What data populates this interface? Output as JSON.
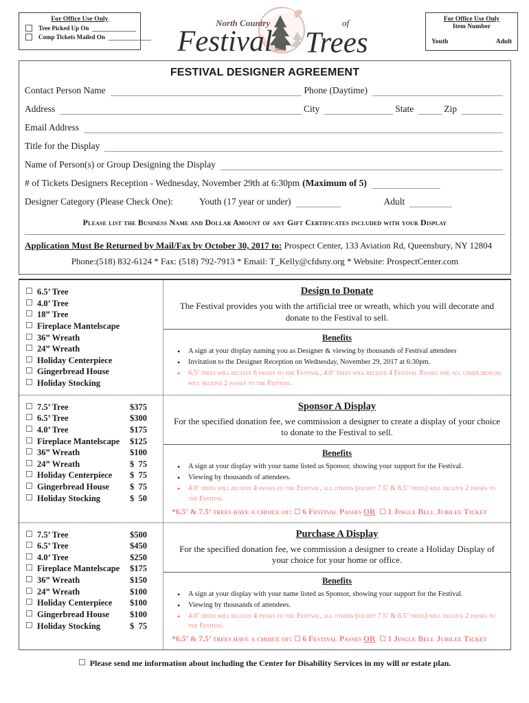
{
  "header": {
    "office_box": {
      "title": "For Office Use Only",
      "rows": [
        {
          "label": "Tree Picked Up On"
        },
        {
          "label": "Comp Tickets Mailed On"
        }
      ]
    },
    "logo": {
      "line_small": "North Country",
      "line_main": "Festival",
      "line_of": "of",
      "line_trees": "Trees"
    },
    "item_box": {
      "title": "For Office Use Only",
      "subtitle": "Item Number",
      "left_label": "Youth",
      "right_label": "Adult"
    }
  },
  "form": {
    "title": "FESTIVAL DESIGNER AGREEMENT",
    "contact_person_label": "Contact Person Name",
    "phone_label": "Phone (Daytime)",
    "address_label": "Address",
    "city_label": "City",
    "state_label": "State",
    "zip_label": "Zip",
    "email_label": "Email Address",
    "title_display_label": "Title for the Display",
    "group_label": "Name of Person(s) or Group Designing the Display",
    "tickets_label": "# of Tickets Designers Reception - Wednesday, November 29th at 6:30pm",
    "tickets_max": "(Maximum of 5)",
    "category_label": "Designer Category (Please Check One):",
    "category_youth": "Youth (17 year or under)",
    "category_adult": "Adult",
    "gift_cert_line": "Please list the Business Name and Dollar Amount of any Gift Certificates included with your Display",
    "return_bold": "Application Must Be Returned by Mail/Fax by October 30, 2017 to:",
    "return_rest": " Prospect Center, 133 Aviation Rd, Queensbury, NY 12804",
    "contact_line": "Phone:(518) 832-6124 * Fax: (518) 792-7913 * Email: T_Kelly@cfdsny.org * Website: ProspectCenter.com"
  },
  "panels": [
    {
      "id": "design-to-donate",
      "title": "Design to Donate",
      "description": "The Festival provides you with the artificial tree or wreath, which you will decorate and donate to the Festival to sell.",
      "benefits_title": "Benefits",
      "options": [
        {
          "name": "6.5’ Tree",
          "price": ""
        },
        {
          "name": "4.0’ Tree",
          "price": ""
        },
        {
          "name": "18” Tree",
          "price": ""
        },
        {
          "name": "Fireplace Mantelscape",
          "price": ""
        },
        {
          "name": "36” Wreath",
          "price": ""
        },
        {
          "name": "24” Wreath",
          "price": ""
        },
        {
          "name": "Holiday Centerpiece",
          "price": ""
        },
        {
          "name": "Gingerbread House",
          "price": ""
        },
        {
          "name": "Holiday Stocking",
          "price": ""
        }
      ],
      "benefits": [
        {
          "text": "A sign at your display naming you as Designer & viewing by thousands of Festival attendees",
          "red": false
        },
        {
          "text": "Invitation to the Designer Reception on Wednesday, November 29, 2017 at 6:30pm.",
          "red": false
        },
        {
          "text": "6.5’ trees will receive 6 passes to the Festival, 4.0’ trees will receive 4 Festival Passes and all other designs will receive 2 passes to the Festival.",
          "red": true
        }
      ],
      "choice_line": null
    },
    {
      "id": "sponsor-a-display",
      "title": "Sponsor A Display",
      "description": "For the specified donation fee, we commission a designer to create a display of your choice to donate to the Festival to sell.",
      "benefits_title": "Benefits",
      "options": [
        {
          "name": "7.5’ Tree",
          "price": "$375"
        },
        {
          "name": "6.5’ Tree",
          "price": "$300"
        },
        {
          "name": "4.0’ Tree",
          "price": "$175"
        },
        {
          "name": "Fireplace Mantelscape",
          "price": "$125"
        },
        {
          "name": "36” Wreath",
          "price": "$100"
        },
        {
          "name": "24” Wreath",
          "price": "$  75"
        },
        {
          "name": "Holiday Centerpiece",
          "price": "$  75"
        },
        {
          "name": "Gingerbread House",
          "price": "$  75"
        },
        {
          "name": "Holiday Stocking",
          "price": "$  50"
        }
      ],
      "benefits": [
        {
          "text": "A sign at your display with your name listed as Sponsor, showing your support for the Festival.",
          "red": false
        },
        {
          "text": "Viewing by thousands of attendees.",
          "red": false
        },
        {
          "text": "4.0’ trees will receive 4 passes to the Festival, all others (except 7.5’ & 6.5’ trees) will receive 2 passes to the Festival.",
          "red": true
        }
      ],
      "choice_line": {
        "prefix": "*6.5’ & 7.5’ trees have a choice of:",
        "option_a": "6 Festival Passes",
        "or": "OR",
        "option_b": "1 Jingle Bell Jubilee Ticket"
      }
    },
    {
      "id": "purchase-a-display",
      "title": "Purchase A Display",
      "description": "For the specified donation fee, we commission a designer to create a Holiday Display of your choice for your home or office.",
      "benefits_title": "Benefits",
      "options": [
        {
          "name": "7.5’ Tree",
          "price": "$500"
        },
        {
          "name": "6.5’ Tree",
          "price": "$450"
        },
        {
          "name": "4.0’ Tree",
          "price": "$250"
        },
        {
          "name": "Fireplace Mantelscape",
          "price": "$175"
        },
        {
          "name": "36” Wreath",
          "price": "$150"
        },
        {
          "name": "24” Wreath",
          "price": "$100"
        },
        {
          "name": "Holiday Centerpiece",
          "price": "$100"
        },
        {
          "name": "Gingerbread House",
          "price": "$100"
        },
        {
          "name": "Holiday Stocking",
          "price": "$  75"
        }
      ],
      "benefits": [
        {
          "text": "A sign at your display with your name listed as Sponsor, showing your support for the Festival.",
          "red": false
        },
        {
          "text": "Viewing by thousands of attendees.",
          "red": false
        },
        {
          "text": "4.0’ trees will receive 4 passes to the Festival, all others (except 7.5’ & 6.5’ trees) will receive 2 passes to the Festival.",
          "red": true
        }
      ],
      "choice_line": {
        "prefix": "*6.5’ & 7.5’ trees have a choice of:",
        "option_a": "6 Festival Passes",
        "or": "OR",
        "option_b": "1 Jingle Bell Jubilee Ticket"
      }
    }
  ],
  "footer": {
    "text": "Please send me information about including the Center for Disability Services in my will or estate plan."
  },
  "colors": {
    "red_text": "#ef8376",
    "red_strong": "#f07d74",
    "border": "#555555",
    "rule": "#9a9a9a"
  }
}
